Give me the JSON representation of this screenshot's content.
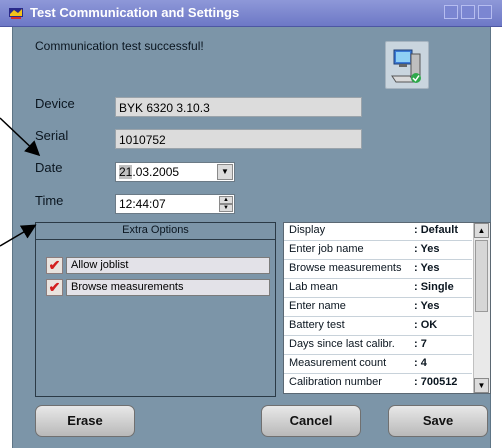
{
  "window": {
    "title": "Test Communication and Settings",
    "app_icon": "app-icon"
  },
  "status": {
    "message": "Communication test successful!"
  },
  "fields": {
    "device_label": "Device",
    "device_value": "BYK 6320 3.10.3",
    "serial_label": "Serial",
    "serial_value": "1010752",
    "date_label": "Date",
    "date_day": "21",
    "date_rest": ".03.2005",
    "time_label": "Time",
    "time_value": "12:44:07"
  },
  "extra_options": {
    "title": "Extra Options",
    "items": [
      {
        "label": "Allow joblist",
        "checked": true
      },
      {
        "label": "Browse measurements",
        "checked": true
      }
    ]
  },
  "info_list": {
    "rows": [
      {
        "key": "Display",
        "value": ": Default"
      },
      {
        "key": "Enter job name",
        "value": ": Yes"
      },
      {
        "key": "Browse measurements",
        "value": ": Yes"
      },
      {
        "key": "Lab mean",
        "value": ": Single"
      },
      {
        "key": "Enter name",
        "value": ": Yes"
      },
      {
        "key": "Battery test",
        "value": ": OK"
      },
      {
        "key": "Days since last calibr.",
        "value": ": 7"
      },
      {
        "key": "Measurement count",
        "value": ": 4"
      },
      {
        "key": "Calibration number",
        "value": ": 700512"
      }
    ]
  },
  "buttons": {
    "erase": "Erase",
    "cancel": "Cancel",
    "save": "Save"
  },
  "colors": {
    "panel": "#7c95a8",
    "titlebar": "#7a84cf",
    "check": "#d31f1f"
  },
  "icons": [
    "computer-network-icon",
    "checkmark-icon",
    "chevron-down-icon",
    "spinner-arrows-icon",
    "scroll-up-icon",
    "scroll-down-icon"
  ]
}
